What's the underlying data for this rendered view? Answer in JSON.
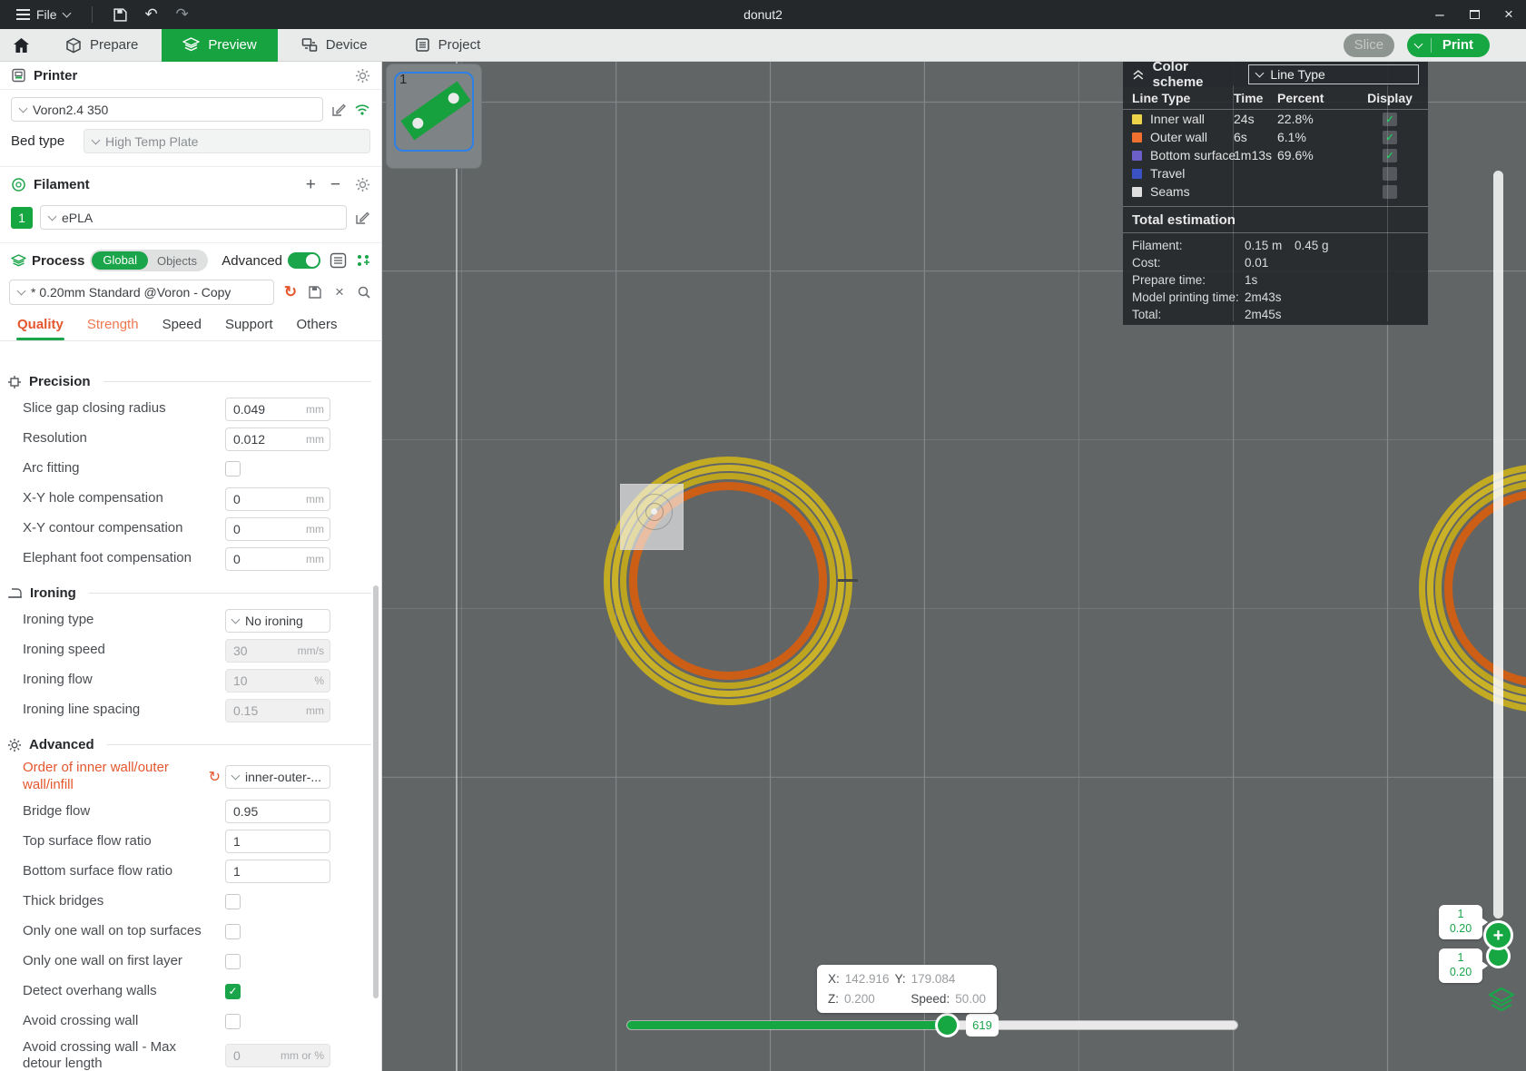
{
  "window": {
    "title": "donut2",
    "file_menu": "File"
  },
  "nav": {
    "tabs": [
      {
        "label": "Prepare"
      },
      {
        "label": "Preview"
      },
      {
        "label": "Device"
      },
      {
        "label": "Project"
      }
    ],
    "slice": "Slice",
    "print": "Print"
  },
  "colors": {
    "accent_green": "#17a742",
    "modified_orange": "#e4572e"
  },
  "printer": {
    "title": "Printer",
    "name": "Voron2.4 350",
    "bed_type_label": "Bed type",
    "bed_type": "High Temp Plate"
  },
  "filament": {
    "title": "Filament",
    "slot": "1",
    "name": "ePLA",
    "add": "+",
    "remove": "−"
  },
  "process": {
    "title": "Process",
    "segments": {
      "global": "Global",
      "objects": "Objects"
    },
    "advanced_label": "Advanced",
    "preset": "* 0.20mm Standard @Voron - Copy",
    "tabs": [
      {
        "label": "Quality"
      },
      {
        "label": "Strength"
      },
      {
        "label": "Speed"
      },
      {
        "label": "Support"
      },
      {
        "label": "Others"
      }
    ]
  },
  "settings": {
    "precision": {
      "title": "Precision",
      "rows": [
        {
          "label": "Slice gap closing radius",
          "value": "0.049",
          "unit": "mm"
        },
        {
          "label": "Resolution",
          "value": "0.012",
          "unit": "mm"
        },
        {
          "label": "Arc fitting",
          "checked": false
        },
        {
          "label": "X-Y hole compensation",
          "value": "0",
          "unit": "mm"
        },
        {
          "label": "X-Y contour compensation",
          "value": "0",
          "unit": "mm"
        },
        {
          "label": "Elephant foot compensation",
          "value": "0",
          "unit": "mm"
        }
      ]
    },
    "ironing": {
      "title": "Ironing",
      "rows": [
        {
          "label": "Ironing type",
          "value": "No ironing"
        },
        {
          "label": "Ironing speed",
          "value": "30",
          "unit": "mm/s",
          "disabled": true
        },
        {
          "label": "Ironing flow",
          "value": "10",
          "unit": "%",
          "disabled": true
        },
        {
          "label": "Ironing line spacing",
          "value": "0.15",
          "unit": "mm",
          "disabled": true
        }
      ]
    },
    "advanced": {
      "title": "Advanced",
      "rows": [
        {
          "label": "Order of inner wall/outer wall/infill",
          "value": "inner-outer-...",
          "modified": true
        },
        {
          "label": "Bridge flow",
          "value": "0.95"
        },
        {
          "label": "Top surface flow ratio",
          "value": "1"
        },
        {
          "label": "Bottom surface flow ratio",
          "value": "1"
        },
        {
          "label": "Thick bridges",
          "checked": false
        },
        {
          "label": "Only one wall on top surfaces",
          "checked": false
        },
        {
          "label": "Only one wall on first layer",
          "checked": false
        },
        {
          "label": "Detect overhang walls",
          "checked": true
        },
        {
          "label": "Avoid crossing wall",
          "checked": false
        },
        {
          "label": "Avoid crossing wall - Max detour length",
          "value": "0",
          "unit": "mm or %",
          "disabled": true
        }
      ]
    }
  },
  "legend": {
    "title": "Color scheme",
    "view_mode": "Line Type",
    "columns": {
      "type": "Line Type",
      "time": "Time",
      "percent": "Percent",
      "display": "Display"
    },
    "rows": [
      {
        "label": "Inner wall",
        "color": "#edd348",
        "time": "24s",
        "percent": "22.8%",
        "display": true
      },
      {
        "label": "Outer wall",
        "color": "#f07030",
        "time": "6s",
        "percent": "6.1%",
        "display": true
      },
      {
        "label": "Bottom surface",
        "color": "#6c5fc7",
        "time": "1m13s",
        "percent": "69.6%",
        "display": true
      },
      {
        "label": "Travel",
        "color": "#3b52c4",
        "time": "",
        "percent": "",
        "display": false
      },
      {
        "label": "Seams",
        "color": "#dfdfdf",
        "time": "",
        "percent": "",
        "display": false
      }
    ],
    "estimation": {
      "title": "Total estimation",
      "rows": [
        {
          "label": "Filament:",
          "value": "0.15 m",
          "value2": "0.45 g"
        },
        {
          "label": "Cost:",
          "value": "0.01",
          "value2": ""
        },
        {
          "label": "Prepare time:",
          "value": "1s",
          "value2": ""
        },
        {
          "label": "Model printing time:",
          "value": "2m43s",
          "value2": ""
        },
        {
          "label": "Total:",
          "value": "2m45s",
          "value2": ""
        }
      ]
    }
  },
  "viewport": {
    "plate_number": "1",
    "tooltip": {
      "x_label": "X:",
      "x": "142.916",
      "y_label": "Y:",
      "y": "179.084",
      "z_label": "Z:",
      "z": "0.200",
      "speed_label": "Speed:",
      "speed": "50.00"
    },
    "h_slider": {
      "value": "619"
    },
    "layer_slider": {
      "top_label": {
        "line1": "1",
        "line2": "0.20"
      },
      "bottom_label": {
        "line1": "1",
        "line2": "0.20"
      }
    }
  }
}
